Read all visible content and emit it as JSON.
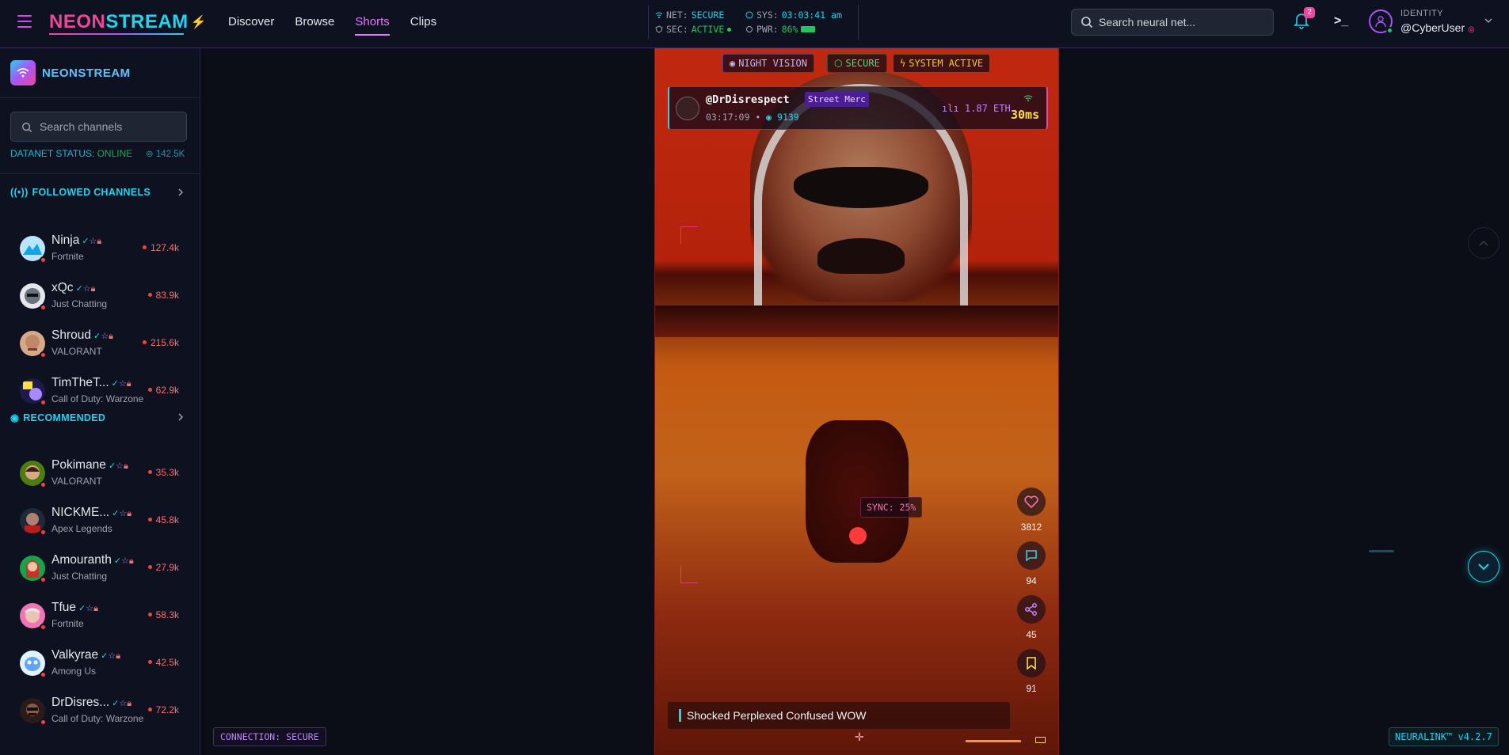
{
  "header": {
    "logo_part1": "NEON",
    "logo_part2": "STREAM",
    "nav": [
      "Discover",
      "Browse",
      "Shorts",
      "Clips"
    ],
    "active_nav": "Shorts",
    "status": {
      "net_label": "NET:",
      "net_value": "SECURE",
      "sys_label": "SYS:",
      "sys_value": "03:03:41 am",
      "sec_label": "SEC:",
      "sec_value": "ACTIVE",
      "pwr_label": "PWR:",
      "pwr_value": "86%"
    },
    "search_placeholder": "Search neural net...",
    "notifications_count": "2",
    "identity_label": "IDENTITY",
    "username": "@CyberUser"
  },
  "sidebar": {
    "title_part1": "NEON",
    "title_part2": "STREAM",
    "search_placeholder": "Search channels",
    "datanet_label": "DATANET STATUS:",
    "datanet_value": "ONLINE",
    "datanet_count": "142.5K",
    "followed_title": "FOLLOWED CHANNELS",
    "recommended_title": "RECOMMENDED",
    "followed": [
      {
        "name": "Ninja",
        "game": "Fortnite",
        "viewers": "127.4k"
      },
      {
        "name": "xQc",
        "game": "Just Chatting",
        "viewers": "83.9k"
      },
      {
        "name": "Shroud",
        "game": "VALORANT",
        "viewers": "215.6k"
      },
      {
        "name": "TimTheT...",
        "game": "Call of Duty: Warzone",
        "viewers": "62.9k"
      }
    ],
    "recommended": [
      {
        "name": "Pokimane",
        "game": "VALORANT",
        "viewers": "35.3k"
      },
      {
        "name": "NICKME...",
        "game": "Apex Legends",
        "viewers": "45.8k"
      },
      {
        "name": "Amouranth",
        "game": "Just Chatting",
        "viewers": "27.9k"
      },
      {
        "name": "Tfue",
        "game": "Fortnite",
        "viewers": "58.3k"
      },
      {
        "name": "Valkyrae",
        "game": "Among Us",
        "viewers": "42.5k"
      },
      {
        "name": "DrDisres...",
        "game": "Call of Duty: Warzone",
        "viewers": "72.2k"
      }
    ]
  },
  "video": {
    "tags": [
      "NIGHT VISION",
      "SECURE",
      "SYSTEM ACTIVE"
    ],
    "streamer": "@DrDisrespect",
    "badge": "Street Merc",
    "uptime": "03:17:09",
    "viewers": "9139",
    "eth": "1.87 ETH",
    "ping": "30ms",
    "sync": "SYNC: 25%",
    "likes": "3812",
    "comments": "94",
    "shares": "45",
    "saves": "91",
    "caption": "Shocked Perplexed Confused WOW",
    "progress": 0.25
  },
  "footer": {
    "connection": "CONNECTION: SECURE",
    "version": "NEURALINK™ v4.2.7"
  },
  "colors": {
    "accent_pink": "#ec4899",
    "accent_cyan": "#22d3ee",
    "accent_purple": "#a855f7",
    "live_red": "#ef4444",
    "online_green": "#22c55e"
  }
}
